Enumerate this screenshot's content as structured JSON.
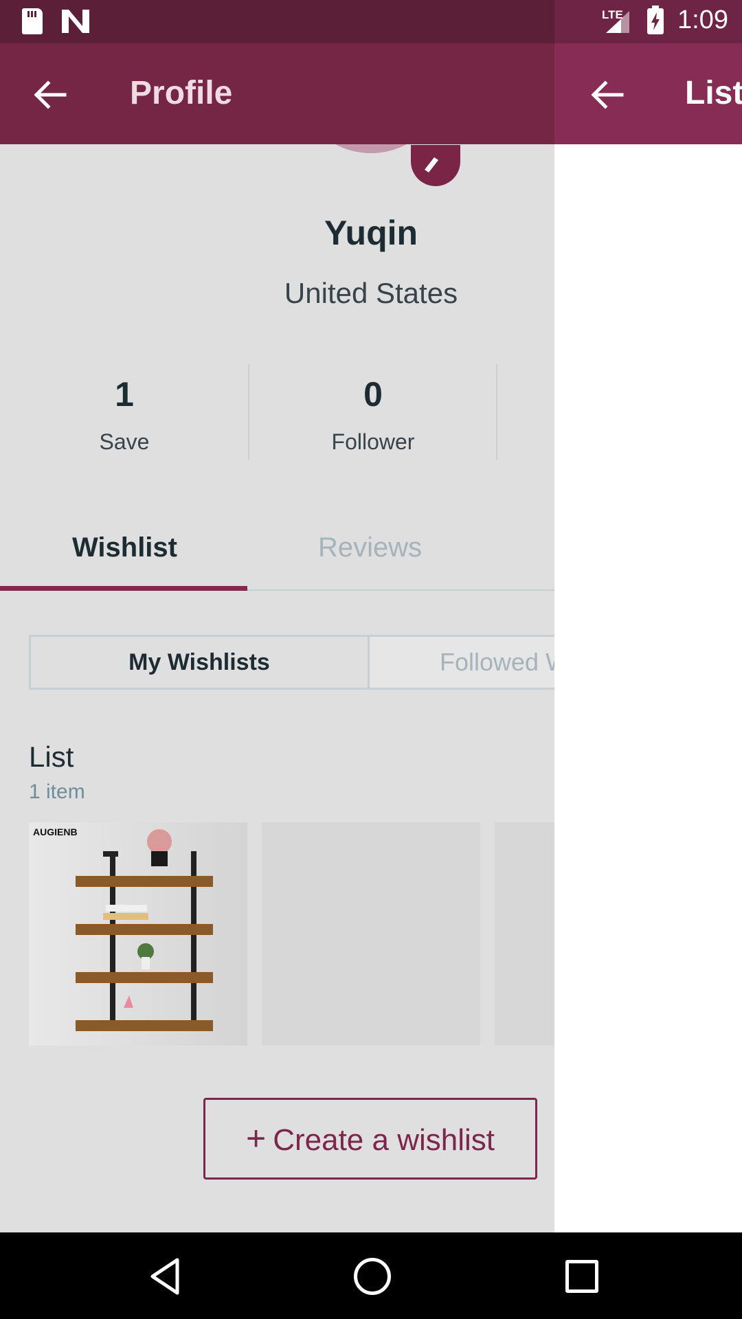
{
  "status_bar": {
    "network": "LTE",
    "time": "1:09"
  },
  "app_bar": {
    "title": "Profile"
  },
  "profile": {
    "name": "Yuqin",
    "location": "United States"
  },
  "stats": [
    {
      "value": "1",
      "label": "Save"
    },
    {
      "value": "0",
      "label": "Follower"
    }
  ],
  "tabs": [
    {
      "label": "Wishlist",
      "active": true
    },
    {
      "label": "Reviews",
      "active": false
    }
  ],
  "segments": [
    {
      "label": "My Wishlists",
      "active": true
    },
    {
      "label": "Followed W",
      "active": false
    }
  ],
  "wishlist": {
    "title": "List",
    "count": "1 item",
    "product_brand": "AUGIENB"
  },
  "create_button": {
    "icon": "+",
    "label": "Create a wishlist"
  },
  "side_panel": {
    "title": "List"
  },
  "colors": {
    "primary": "#762645",
    "accent": "#822b4d",
    "status_bar": "#5b1f38"
  }
}
